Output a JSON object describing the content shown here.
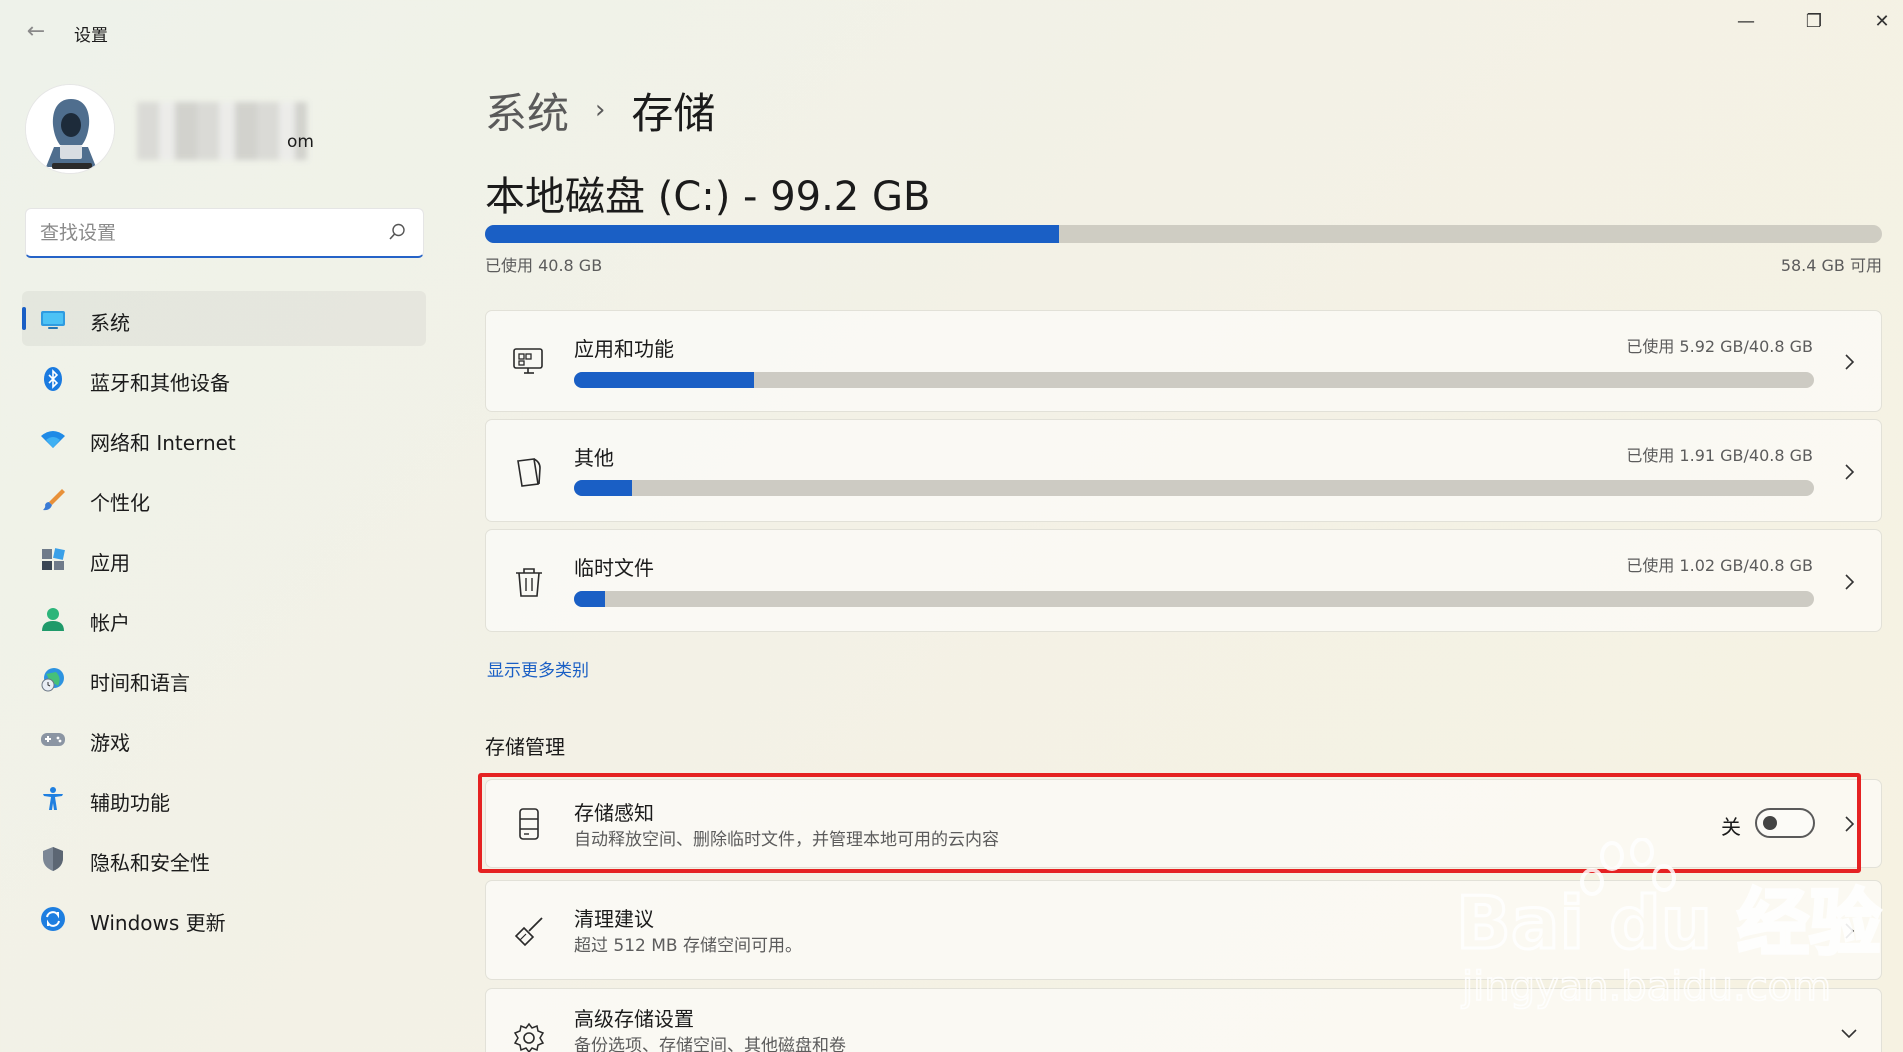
{
  "window": {
    "title": "设置",
    "controls": {
      "minimize": "—",
      "maximize": "❐",
      "close": "✕"
    }
  },
  "profile": {
    "email_tail": "om"
  },
  "search": {
    "placeholder": "查找设置"
  },
  "nav": {
    "items": [
      {
        "label": "系统",
        "icon": "system-icon",
        "active": true
      },
      {
        "label": "蓝牙和其他设备",
        "icon": "bluetooth-icon"
      },
      {
        "label": "网络和 Internet",
        "icon": "wifi-icon"
      },
      {
        "label": "个性化",
        "icon": "brush-icon"
      },
      {
        "label": "应用",
        "icon": "apps-icon"
      },
      {
        "label": "帐户",
        "icon": "account-icon"
      },
      {
        "label": "时间和语言",
        "icon": "globe-clock-icon"
      },
      {
        "label": "游戏",
        "icon": "gamepad-icon"
      },
      {
        "label": "辅助功能",
        "icon": "accessibility-icon"
      },
      {
        "label": "隐私和安全性",
        "icon": "shield-icon"
      },
      {
        "label": "Windows 更新",
        "icon": "windows-update-icon"
      }
    ]
  },
  "breadcrumb": {
    "parent": "系统",
    "separator": "›",
    "current": "存储"
  },
  "disk": {
    "title": "本地磁盘 (C:) - 99.2 GB",
    "used_label": "已使用 40.8 GB",
    "free_label": "58.4 GB 可用",
    "used_fraction": 0.411
  },
  "categories": [
    {
      "title": "应用和功能",
      "usage": "已使用 5.92 GB/40.8 GB",
      "fraction": 0.145,
      "icon": "apps-features-icon"
    },
    {
      "title": "其他",
      "usage": "已使用 1.91 GB/40.8 GB",
      "fraction": 0.047,
      "icon": "other-files-icon"
    },
    {
      "title": "临时文件",
      "usage": "已使用 1.02 GB/40.8 GB",
      "fraction": 0.025,
      "icon": "trash-icon"
    }
  ],
  "show_more": "显示更多类别",
  "storage_management": {
    "title": "存储管理",
    "storage_sense": {
      "title": "存储感知",
      "subtitle": "自动释放空间、删除临时文件，并管理本地可用的云内容",
      "toggle_label": "关",
      "toggle_on": false
    },
    "cleanup": {
      "title": "清理建议",
      "subtitle": "超过 512 MB 存储空间可用。"
    },
    "advanced": {
      "title": "高级存储设置",
      "subtitle": "备份选项、存储空间、其他磁盘和卷"
    }
  },
  "colors": {
    "accent": "#1a5fc5",
    "highlight": "#e52222",
    "bar_track": "#cdcbc3"
  },
  "watermark": {
    "brand": "Bai du 经验",
    "url": "jingyan.baidu.com"
  }
}
